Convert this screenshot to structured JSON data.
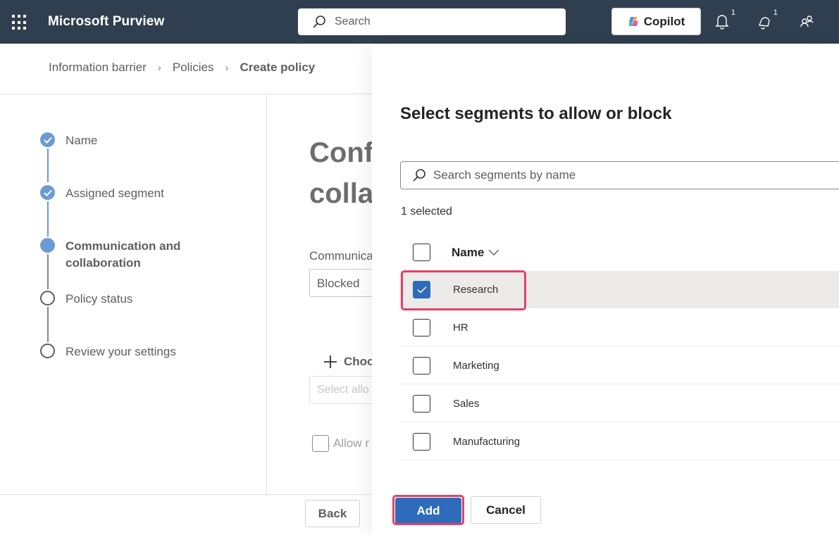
{
  "topbar": {
    "app_title": "Microsoft Purview",
    "search_placeholder": "Search",
    "copilot_label": "Copilot",
    "notifications_badge": "1",
    "bell_badge": "1"
  },
  "breadcrumb": {
    "items": [
      "Information barrier",
      "Policies",
      "Create policy"
    ]
  },
  "steps": [
    {
      "label": "Name",
      "state": "done"
    },
    {
      "label": "Assigned segment",
      "state": "done"
    },
    {
      "label": "Communication and collaboration",
      "state": "current"
    },
    {
      "label": "Policy status",
      "state": "todo"
    },
    {
      "label": "Review your settings",
      "state": "todo"
    }
  ],
  "form": {
    "title_line1": "Conf",
    "title_line2": "collal",
    "communication_label": "Communica",
    "communication_value": "Blocked",
    "choose_label": "Choo",
    "select_placeholder": "Select allo",
    "allow_label": "Allow r",
    "back_label": "Back"
  },
  "panel": {
    "title": "Select segments to allow or block",
    "search_placeholder": "Search segments by name",
    "selected_count": "1 selected",
    "column_name": "Name",
    "rows": [
      {
        "name": "Research",
        "checked": true
      },
      {
        "name": "HR",
        "checked": false
      },
      {
        "name": "Marketing",
        "checked": false
      },
      {
        "name": "Sales",
        "checked": false
      },
      {
        "name": "Manufacturing",
        "checked": false
      }
    ],
    "add_label": "Add",
    "cancel_label": "Cancel"
  },
  "colors": {
    "topbar_bg": "#303f4f",
    "accent": "#2e6cbb",
    "step_blue": "#6b9bd2",
    "highlight": "#e0426a"
  }
}
